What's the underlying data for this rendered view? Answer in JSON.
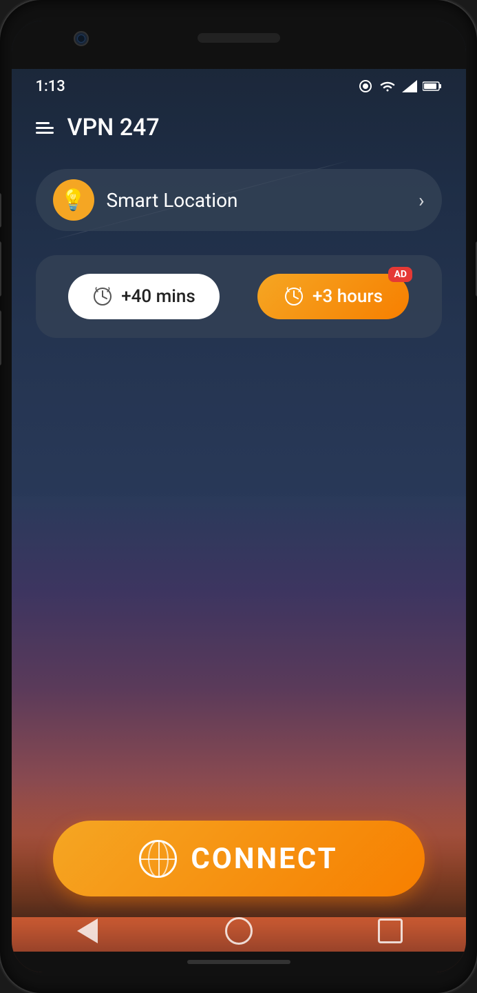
{
  "device": {
    "time": "1:13",
    "speaker_label": "speaker",
    "camera_label": "front-camera"
  },
  "status_bar": {
    "time": "1:13",
    "icons": [
      "recording",
      "wifi",
      "signal",
      "battery"
    ]
  },
  "header": {
    "menu_label": "menu",
    "title": "VPN 247"
  },
  "location": {
    "label": "Smart Location",
    "icon": "💡",
    "chevron": "›"
  },
  "time_boost": {
    "btn_white_label": "+40 mins",
    "btn_orange_label": "+3 hours",
    "ad_badge": "AD"
  },
  "connect": {
    "label": "CONNECT"
  },
  "nav": {
    "back": "back",
    "home": "home",
    "recent": "recent"
  },
  "colors": {
    "orange": "#f5a623",
    "orange_dark": "#f77f00",
    "red": "#e53935",
    "white": "#ffffff"
  }
}
